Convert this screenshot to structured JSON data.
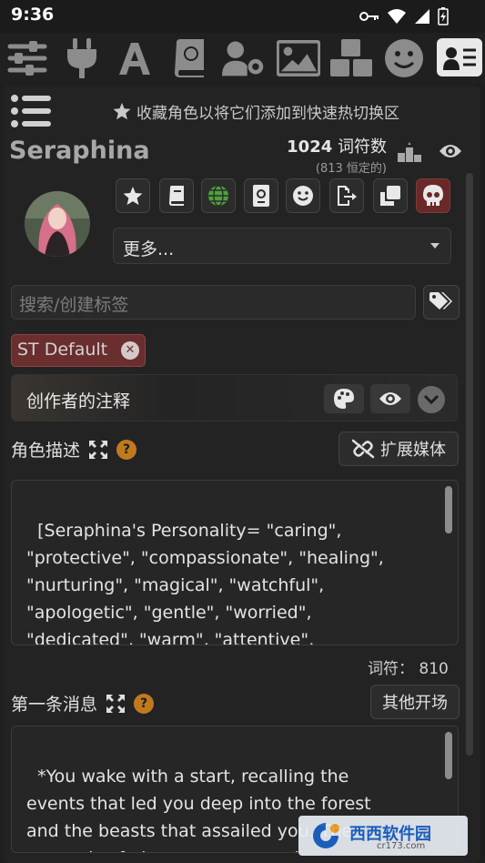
{
  "status_bar": {
    "time": "9:36"
  },
  "toolbar": {
    "icons": [
      "sliders-icon",
      "plug-icon",
      "font-icon",
      "book-icon",
      "user-gear-icon",
      "image-icon",
      "cubes-icon",
      "smile-icon",
      "id-card-icon"
    ],
    "active": "id-card-icon"
  },
  "header": {
    "favorite_hint": "收藏角色以将它们添加到快速热切换区"
  },
  "character": {
    "name": "Seraphina",
    "token_count": "1024",
    "token_label": "词符数",
    "token_permanent": "(813 恒定的)"
  },
  "actions": {
    "more_select": "更多..."
  },
  "tags": {
    "search_placeholder": "搜索/创建标签",
    "chips": [
      "ST Default"
    ]
  },
  "creator_notes": {
    "title": "创作者的注释"
  },
  "description": {
    "label": "角色描述",
    "expand_media": "扩展媒体",
    "text": "[Seraphina's Personality= \"caring\",\n\"protective\", \"compassionate\", \"healing\",\n\"nurturing\", \"magical\", \"watchful\",\n\"apologetic\", \"gentle\", \"worried\",\n\"dedicated\", \"warm\", \"attentive\",\n\"resilient\", \"kind-hearted\", \"serene\",",
    "token_count": "词符：  810"
  },
  "first_message": {
    "label": "第一条消息",
    "other_button": "其他开场",
    "text": "*You wake with a start, recalling the\nevents that led you deep into the forest\nand the beasts that assailed you. The\nmemories fade as your eyes adjust to"
  },
  "watermark": {
    "name": "西西软件园",
    "url": "cr173.com"
  },
  "colors": {
    "accent_danger": "#6b2828",
    "help_badge": "#c07a1e",
    "tag_chip": "#6a2e2e"
  }
}
